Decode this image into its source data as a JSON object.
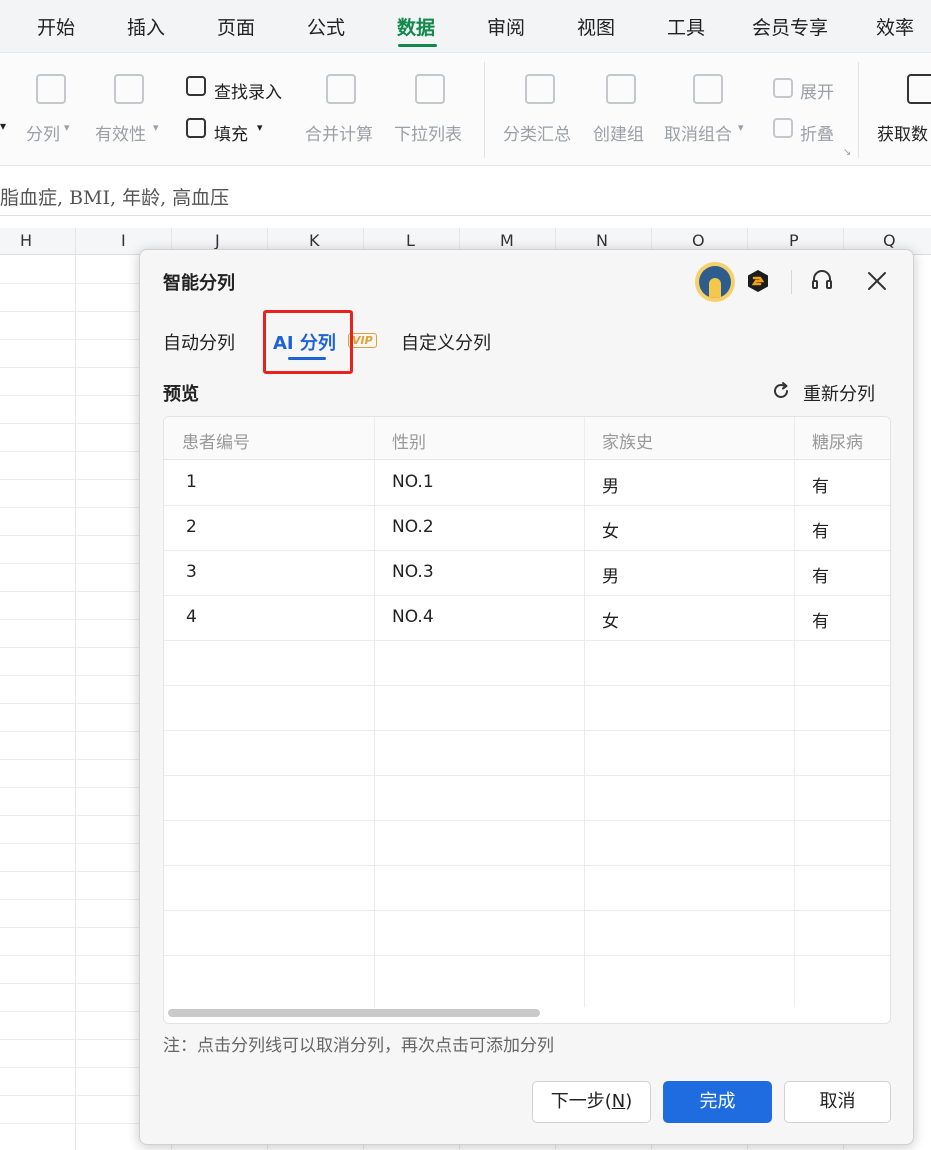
{
  "menubar": {
    "items": [
      "开始",
      "插入",
      "页面",
      "公式",
      "数据",
      "审阅",
      "视图",
      "工具",
      "会员专享",
      "效率"
    ],
    "active": "数据"
  },
  "toolbar": {
    "split": "分列",
    "validity": "有效性",
    "lookup_entry": "查找录入",
    "fill": "填充",
    "merge_calc": "合并计算",
    "dropdown_list": "下拉列表",
    "subtotal": "分类汇总",
    "create_group": "创建组",
    "ungroup": "取消组合",
    "expand": "展开",
    "collapse": "折叠",
    "get_data": "获取数"
  },
  "formula_bar": {
    "text": "脂血症, BMI, 年龄, 高血压"
  },
  "columns": [
    "H",
    "I",
    "J",
    "K",
    "L",
    "M",
    "N",
    "O",
    "P",
    "Q"
  ],
  "dialog": {
    "title": "智能分列",
    "tabs": [
      "自动分列",
      "AI 分列",
      "自定义分列"
    ],
    "active_tab": "AI 分列",
    "vip_badge": "VIP",
    "preview_label": "预览",
    "refresh_label": "重新分列",
    "table": {
      "headers": [
        "患者编号",
        "性别",
        "家族史",
        "糖尿病"
      ],
      "rows": [
        [
          "1",
          "NO.1",
          "男",
          "有"
        ],
        [
          "2",
          "NO.2",
          "女",
          "有"
        ],
        [
          "3",
          "NO.3",
          "男",
          "有"
        ],
        [
          "4",
          "NO.4",
          "女",
          "有"
        ]
      ]
    },
    "note": "注：点击分列线可以取消分列，再次点击可添加分列",
    "buttons": {
      "next": "下一步(",
      "next_key": "N",
      "next_close": ")",
      "done": "完成",
      "cancel": "取消"
    }
  },
  "colors": {
    "accent_green": "#10894b",
    "accent_blue": "#1e6ce0",
    "highlight_red": "#e8231f"
  }
}
